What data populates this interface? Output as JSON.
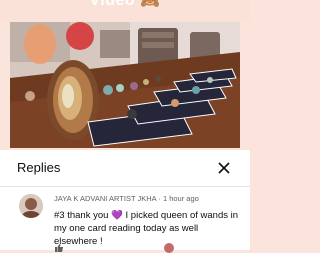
{
  "video": {
    "title_fragment": "Video 🙈"
  },
  "replies_panel": {
    "title": "Replies",
    "close_icon": "close-icon"
  },
  "comment": {
    "author": "JAYA K ADVANI ARTIST JKHA",
    "separator": "·",
    "time": "1 hour ago",
    "text_before_emoji": "#3 thank you ",
    "emoji": "💜",
    "text_after_emoji": " I picked queen of wands in my one card reading today as well elsewhere !"
  },
  "colors": {
    "page_background": "#fbe4dc",
    "panel_background": "#ffffff",
    "meta_text": "#606060",
    "body_text": "#0f0f0f"
  }
}
